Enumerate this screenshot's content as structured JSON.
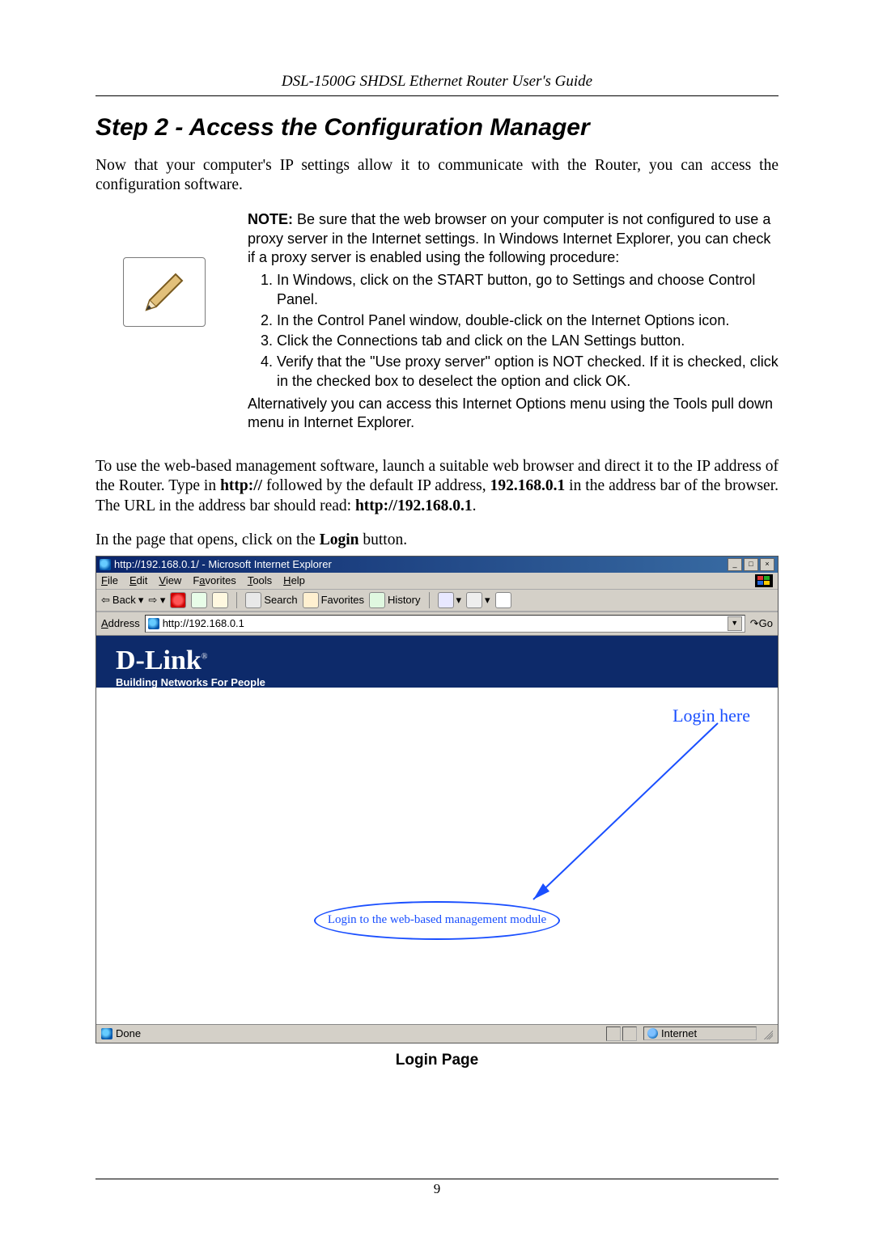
{
  "running_header": "DSL-1500G SHDSL Ethernet Router User's Guide",
  "step_title": "Step 2 - Access the Configuration  Manager",
  "intro_paragraph": "Now that your computer's IP settings allow it to communicate with the Router, you can access the configuration software.",
  "note": {
    "label": "NOTE:",
    "lead": " Be sure that the web browser on your computer is not configured to use a proxy server in the Internet settings. In Windows Internet Explorer, you can check if a proxy server is enabled using the following procedure:",
    "items": [
      "In Windows, click on the START button, go to Settings and choose Control Panel.",
      "In the Control Panel window, double-click on the Internet Options icon.",
      "Click the Connections tab and click on the LAN Settings button.",
      "Verify that the \"Use proxy server\" option is NOT checked. If it is checked, click in the checked box to deselect the option and click OK."
    ],
    "trailer": "Alternatively you can access this Internet Options menu using the Tools pull down menu in Internet Explorer."
  },
  "paragraph2_prebold1": "To use the web-based management software, launch a suitable web browser and direct it to the IP address of the Router. Type in ",
  "paragraph2_bold1": "http://",
  "paragraph2_mid1": " followed by the default IP address, ",
  "paragraph2_bold2": "192.168.0.1",
  "paragraph2_mid2": " in the address bar of the browser. The URL in the address bar should read: ",
  "paragraph2_bold3": "http://192.168.0.1",
  "paragraph2_tail": ".",
  "paragraph3_pre": "In the page that opens, click on the ",
  "paragraph3_bold": "Login",
  "paragraph3_post": " button.",
  "browser": {
    "title": "http://192.168.0.1/ - Microsoft Internet Explorer",
    "menu": {
      "file": "File",
      "edit": "Edit",
      "view": "View",
      "favorites": "Favorites",
      "tools": "Tools",
      "help": "Help"
    },
    "toolbar": {
      "back": "Back",
      "search": "Search",
      "favorites": "Favorites",
      "history": "History"
    },
    "address_label": "Address",
    "address_value": "http://192.168.0.1",
    "go_label": "Go",
    "status_done": "Done",
    "status_zone": "Internet"
  },
  "dlink": {
    "logo": "D-Link",
    "reg": "®",
    "tagline": "Building Networks For People",
    "login_here": "Login here",
    "login_button_text": "Login to the web-based management module"
  },
  "caption": "Login Page",
  "page_number": "9"
}
